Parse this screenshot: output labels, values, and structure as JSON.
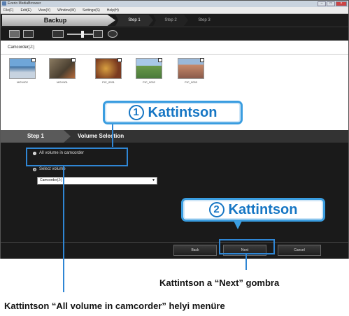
{
  "window": {
    "title": "Everio MediaBrowser"
  },
  "menu": [
    "File(F)",
    "Edit(E)",
    "View(V)",
    "Window(W)",
    "Settings(S)",
    "Help(H)"
  ],
  "tabs": {
    "backup": "Backup",
    "step1": "Step 1",
    "step2": "Step 2",
    "step3": "Step 3"
  },
  "browser": {
    "header": "Camcorder(J:)",
    "files": [
      "MOV002",
      "MOV001",
      "PIC_0031",
      "PIC_0032",
      "PIC_0033"
    ]
  },
  "wizard": {
    "step_label": "Step 1",
    "title": "Volume Selection",
    "option_all": "All volume in camcorder",
    "option_select": "Select volume",
    "select_value": "Camcorder(J:)",
    "back": "Back",
    "next": "Next",
    "cancel": "Cancel"
  },
  "callouts": {
    "c1_num": "1",
    "c1_text": "Kattintson",
    "c2_num": "2",
    "c2_text": "Kattintson"
  },
  "captions": {
    "next_caption": "Kattintson a “Next” gombra",
    "all_caption": "Kattintson “All volume in camcorder” helyi menüre"
  },
  "colors": {
    "accent": "#2f86d4",
    "callout_text": "#1676c4"
  }
}
